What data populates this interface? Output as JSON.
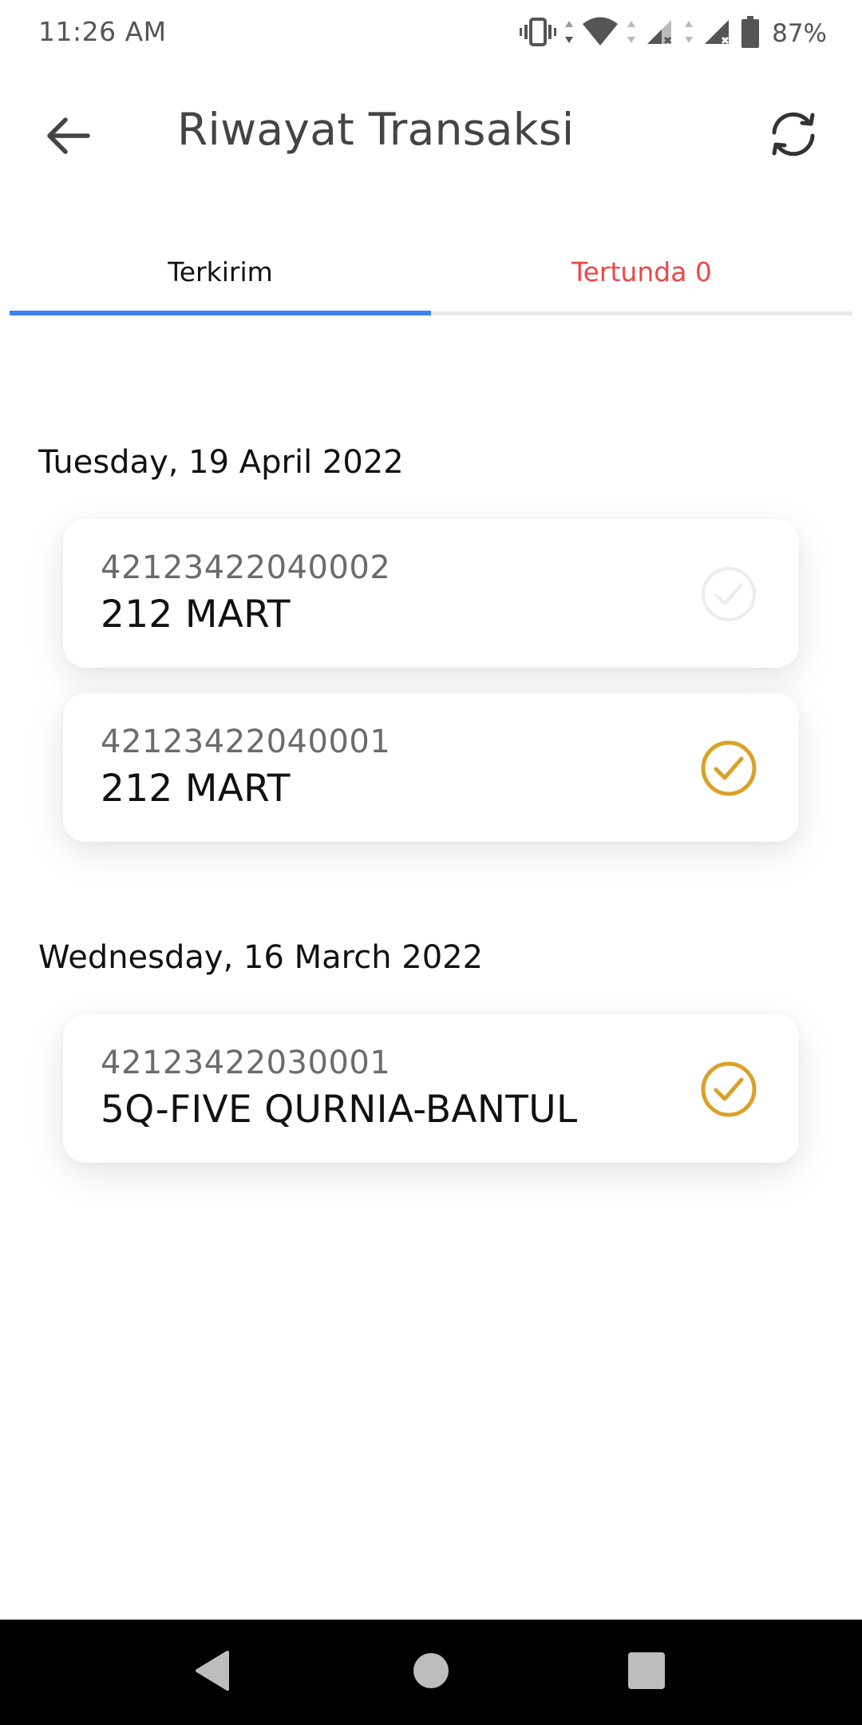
{
  "status_bar": {
    "time": "11:26 AM",
    "battery": "87%",
    "icons": [
      "vibrate-icon",
      "wifi-icon",
      "signal-icon",
      "signal-icon",
      "battery-icon"
    ]
  },
  "app_bar": {
    "title": "Riwayat Transaksi",
    "back_icon": "arrow-left-icon",
    "refresh_icon": "refresh-icon"
  },
  "tabs": [
    {
      "label": "Terkirim",
      "active": true,
      "color": "#111111"
    },
    {
      "label": "Tertunda 0",
      "active": false,
      "color": "#ef4646"
    }
  ],
  "accent_color": "#3c82ee",
  "check_color": "#d9a128",
  "groups": [
    {
      "date": "Tuesday, 19 April 2022",
      "items": [
        {
          "number": "42123422040002",
          "name": "212 MART",
          "status_icon": "check-circle-icon",
          "status": "faded"
        },
        {
          "number": "42123422040001",
          "name": "212 MART",
          "status_icon": "check-circle-icon",
          "status": "done"
        }
      ]
    },
    {
      "date": "Wednesday, 16 March 2022",
      "items": [
        {
          "number": "42123422030001",
          "name": "5Q-FIVE QURNIA-BANTUL",
          "status_icon": "check-circle-icon",
          "status": "done"
        }
      ]
    }
  ],
  "nav_bar": {
    "icons": [
      "back-triangle-icon",
      "home-circle-icon",
      "recents-square-icon"
    ]
  }
}
